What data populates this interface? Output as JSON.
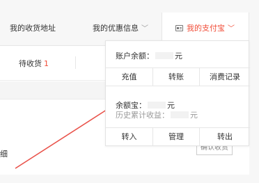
{
  "nav": {
    "address": "我的收货地址",
    "coupons": "我的优惠信息",
    "alipay": "我的支付宝",
    "chevron": "﹀"
  },
  "orders": {
    "pending_label": "待收货",
    "pending_count": "1",
    "detail_text": "细",
    "confirm_button": "确认收货"
  },
  "alipay_menu": {
    "balance_label": "账户余额：",
    "balance_unit": "元",
    "row1": [
      "充值",
      "转账",
      "消费记录"
    ],
    "yuebao_label": "余额宝：",
    "yuebao_unit": "元",
    "history_label": "历史累计收益：",
    "history_unit": "元",
    "row2": [
      "转入",
      "管理",
      "转出"
    ]
  },
  "colors": {
    "accent": "#f14d38",
    "arrow": "#e9524a"
  },
  "icons": {
    "alipay": "card-icon",
    "dropdown": "chevron-down-icon"
  }
}
